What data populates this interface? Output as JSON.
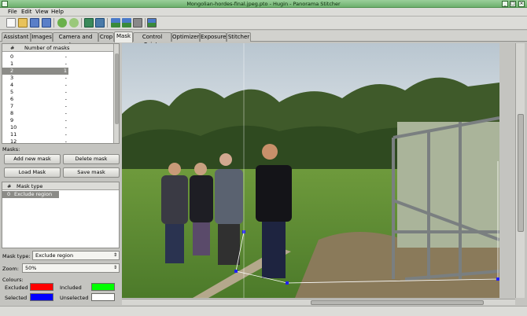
{
  "window": {
    "title": "Mongolian-hordes-final.jpeg.pto - Hugin - Panorama Stitcher"
  },
  "menu": {
    "file": "File",
    "edit": "Edit",
    "view": "View",
    "help": "Help"
  },
  "tabs": [
    {
      "label": "Assistant"
    },
    {
      "label": "Images"
    },
    {
      "label": "Camera and Lens"
    },
    {
      "label": "Crop"
    },
    {
      "label": "Mask"
    },
    {
      "label": "Control Points"
    },
    {
      "label": "Optimizer"
    },
    {
      "label": "Exposure"
    },
    {
      "label": "Stitcher"
    }
  ],
  "image_list": {
    "col_index": "#",
    "col_masks": "Number of masks",
    "rows": [
      {
        "index": "0",
        "masks": "-"
      },
      {
        "index": "1",
        "masks": "-"
      },
      {
        "index": "2",
        "masks": "1"
      },
      {
        "index": "3",
        "masks": "-"
      },
      {
        "index": "4",
        "masks": "-"
      },
      {
        "index": "5",
        "masks": "-"
      },
      {
        "index": "6",
        "masks": "-"
      },
      {
        "index": "7",
        "masks": "-"
      },
      {
        "index": "8",
        "masks": "-"
      },
      {
        "index": "9",
        "masks": "-"
      },
      {
        "index": "10",
        "masks": "-"
      },
      {
        "index": "11",
        "masks": "-"
      },
      {
        "index": "12",
        "masks": "-"
      }
    ]
  },
  "masks": {
    "label": "Masks:",
    "add": "Add new mask",
    "delete": "Delete mask",
    "load": "Load Mask",
    "save": "Save mask",
    "col_index": "#",
    "col_type": "Mask type",
    "rows": [
      {
        "index": "0",
        "type": "Exclude region"
      }
    ]
  },
  "mask_type": {
    "label": "Mask type:",
    "value": "Exclude region"
  },
  "zoom": {
    "label": "Zoom:",
    "value": "50%"
  },
  "colours": {
    "label": "Colours:",
    "excluded": "Excluded",
    "excluded_color": "#ff0000",
    "included": "Included",
    "included_color": "#00ff00",
    "selected": "Selected",
    "selected_color": "#0000ff",
    "unselected": "Unselected",
    "unselected_color": "#ffffff"
  }
}
